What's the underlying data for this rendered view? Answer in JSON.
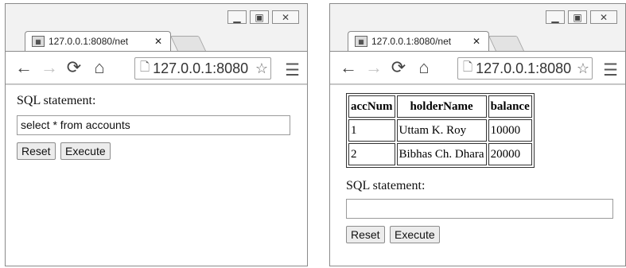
{
  "left": {
    "tab_title": "127.0.0.1:8080/net",
    "address": "127.0.0.1:8080",
    "sql_label": "SQL statement:",
    "sql_value": "select * from accounts",
    "reset_label": "Reset",
    "execute_label": "Execute"
  },
  "right": {
    "tab_title": "127.0.0.1:8080/net",
    "address": "127.0.0.1:8080",
    "table": {
      "headers": [
        "accNum",
        "holderName",
        "balance"
      ],
      "rows": [
        [
          "1",
          "Uttam K. Roy",
          "10000"
        ],
        [
          "2",
          "Bibhas Ch. Dhara",
          "20000"
        ]
      ]
    },
    "sql_label": "SQL statement:",
    "sql_value": "",
    "reset_label": "Reset",
    "execute_label": "Execute"
  },
  "icons": {
    "minimize": "minimize-icon",
    "maximize": "maximize-icon",
    "close": "close-icon",
    "back": "back-arrow-icon",
    "forward": "forward-arrow-icon",
    "reload": "reload-icon",
    "home": "home-icon",
    "page": "page-icon",
    "star": "star-icon",
    "menu": "hamburger-menu-icon"
  }
}
